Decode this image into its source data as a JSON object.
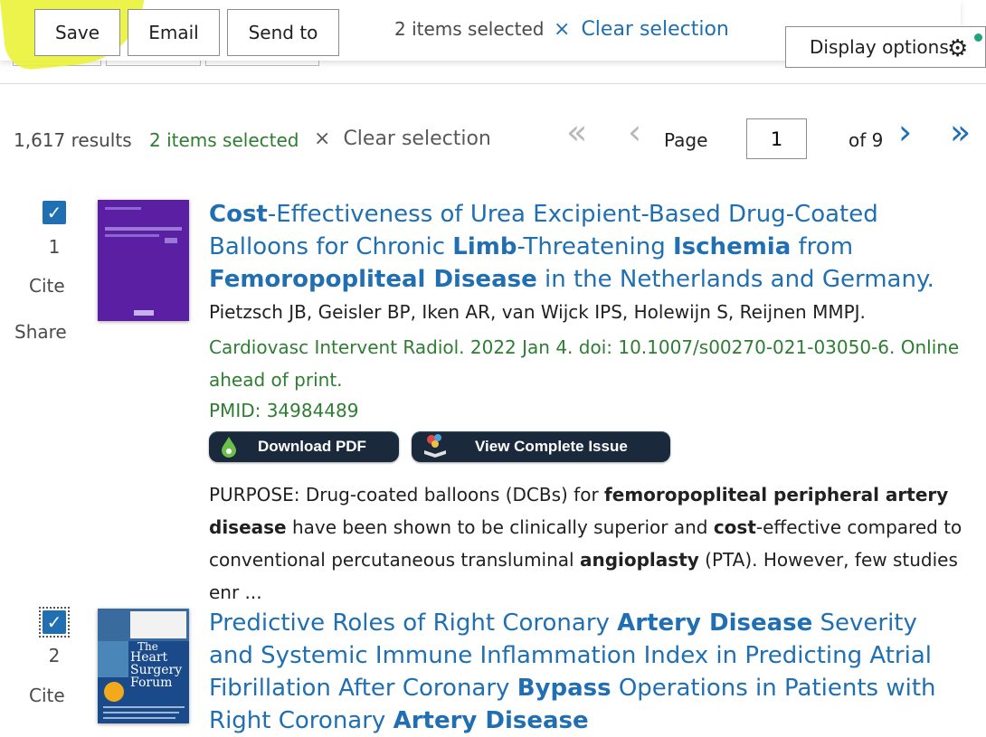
{
  "toolbar": {
    "save_label": "Save",
    "email_label": "Email",
    "send_to_label": "Send to",
    "selected_text": "2 items selected",
    "clear_icon": "×",
    "clear_label": "Clear selection",
    "display_options_label": "Display options",
    "gear_icon": "gear-icon"
  },
  "results_header": {
    "count": "1,617 results",
    "selected_text": "2 items selected",
    "clear_icon": "×",
    "clear_label": "Clear selection",
    "page_label": "Page",
    "page_value": "1",
    "of_label": "of 9"
  },
  "results": [
    {
      "num": "1",
      "cite": "Cite",
      "share": "Share",
      "title_parts": [
        {
          "t": "Cost",
          "b": true
        },
        {
          "t": "-Effectiveness of Urea Excipient-Based Drug-Coated Balloons for Chronic ",
          "b": false
        },
        {
          "t": "Limb",
          "b": true
        },
        {
          "t": "-Threatening ",
          "b": false
        },
        {
          "t": "Ischemia",
          "b": true
        },
        {
          "t": " from ",
          "b": false
        },
        {
          "t": "Femoropopliteal Disease",
          "b": true
        },
        {
          "t": " in the Netherlands and Germany.",
          "b": false
        }
      ],
      "authors": "Pietzsch JB, Geisler BP, Iken AR, van Wijck IPS, Holewijn S, Reijnen MMPJ.",
      "citation": "Cardiovasc Intervent Radiol. 2022 Jan 4. doi: 10.1007/s00270-021-03050-6. Online ahead of print.",
      "pmid": "PMID: 34984489",
      "download_pdf": "Download PDF",
      "view_issue": "View Complete Issue",
      "snippet_parts": [
        {
          "t": "PURPOSE: Drug-coated balloons (DCBs) for ",
          "b": false
        },
        {
          "t": "femoropopliteal peripheral artery disease",
          "b": true
        },
        {
          "t": " have been shown to be clinically superior and ",
          "b": false
        },
        {
          "t": "cost",
          "b": true
        },
        {
          "t": "-effective compared to conventional percutaneous transluminal ",
          "b": false
        },
        {
          "t": "angioplasty",
          "b": true
        },
        {
          "t": " (PTA). However, few studies enr ...",
          "b": false
        }
      ],
      "cover_color": "#5b1fa3"
    },
    {
      "num": "2",
      "cite": "Cite",
      "title_parts": [
        {
          "t": "Predictive Roles of Right Coronary ",
          "b": false
        },
        {
          "t": "Artery Disease",
          "b": true
        },
        {
          "t": " Severity and Systemic Immune Inflammation Index in Predicting Atrial Fibrillation After Coronary ",
          "b": false
        },
        {
          "t": "Bypass",
          "b": true
        },
        {
          "t": " Operations in Patients with Right Coronary ",
          "b": false
        },
        {
          "t": "Artery Disease",
          "b": true
        }
      ],
      "cover_title": "Heart Surgery Forum",
      "cover_the": "The",
      "cover_color": "#1a4a8a"
    }
  ]
}
